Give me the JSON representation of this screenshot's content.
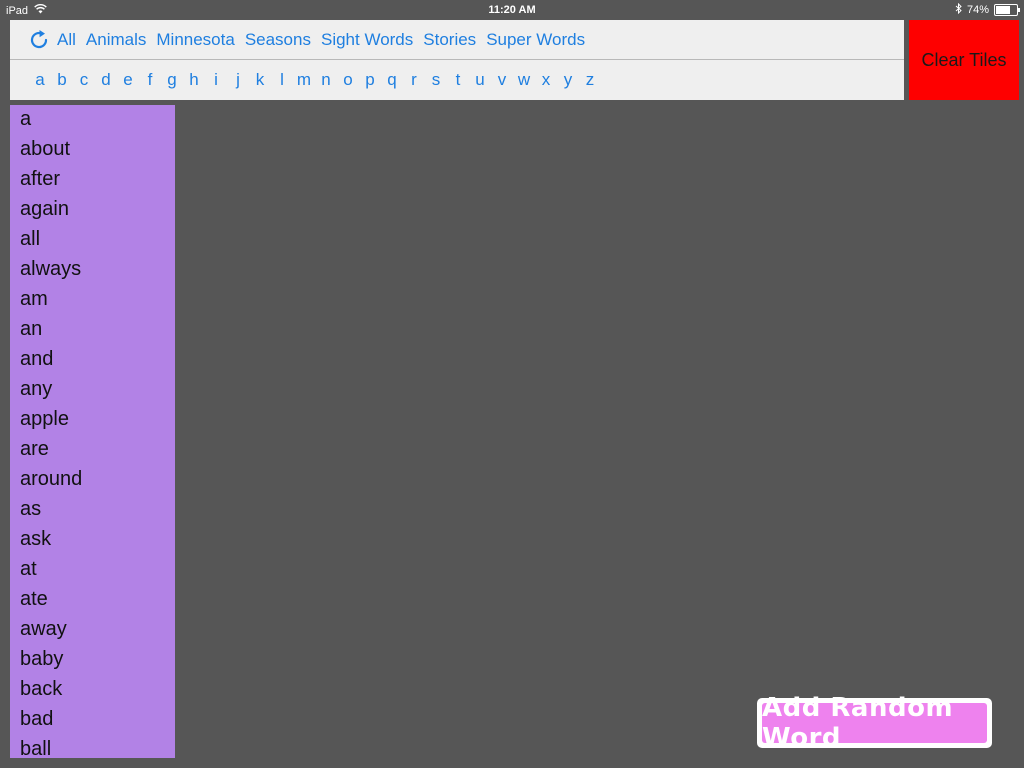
{
  "status_bar": {
    "device": "iPad",
    "time": "11:20 AM",
    "battery_percent_label": "74%",
    "battery_level": 0.74,
    "icons": [
      "wifi-icon",
      "bluetooth-icon",
      "battery-icon"
    ]
  },
  "toolbar": {
    "refresh_icon": "refresh-icon",
    "categories": [
      "All",
      "Animals",
      "Minnesota",
      "Seasons",
      "Sight Words",
      "Stories",
      "Super Words"
    ],
    "letters": [
      "a",
      "b",
      "c",
      "d",
      "e",
      "f",
      "g",
      "h",
      "i",
      "j",
      "k",
      "l",
      "m",
      "n",
      "o",
      "p",
      "q",
      "r",
      "s",
      "t",
      "u",
      "v",
      "w",
      "x",
      "y",
      "z"
    ]
  },
  "clear_tiles_label": "Clear Tiles",
  "word_list": [
    "a",
    "about",
    "after",
    "again",
    "all",
    "always",
    "am",
    "an",
    "and",
    "any",
    "apple",
    "are",
    "around",
    "as",
    "ask",
    "at",
    "ate",
    "away",
    "baby",
    "back",
    "bad",
    "ball"
  ],
  "add_random_word_label": "Add Random Word",
  "colors": {
    "background": "#565656",
    "accent_link": "#1f7fe0",
    "clear_button": "#fe0000",
    "word_list_bg": "#b282e6",
    "random_button": "#ee82ee"
  }
}
